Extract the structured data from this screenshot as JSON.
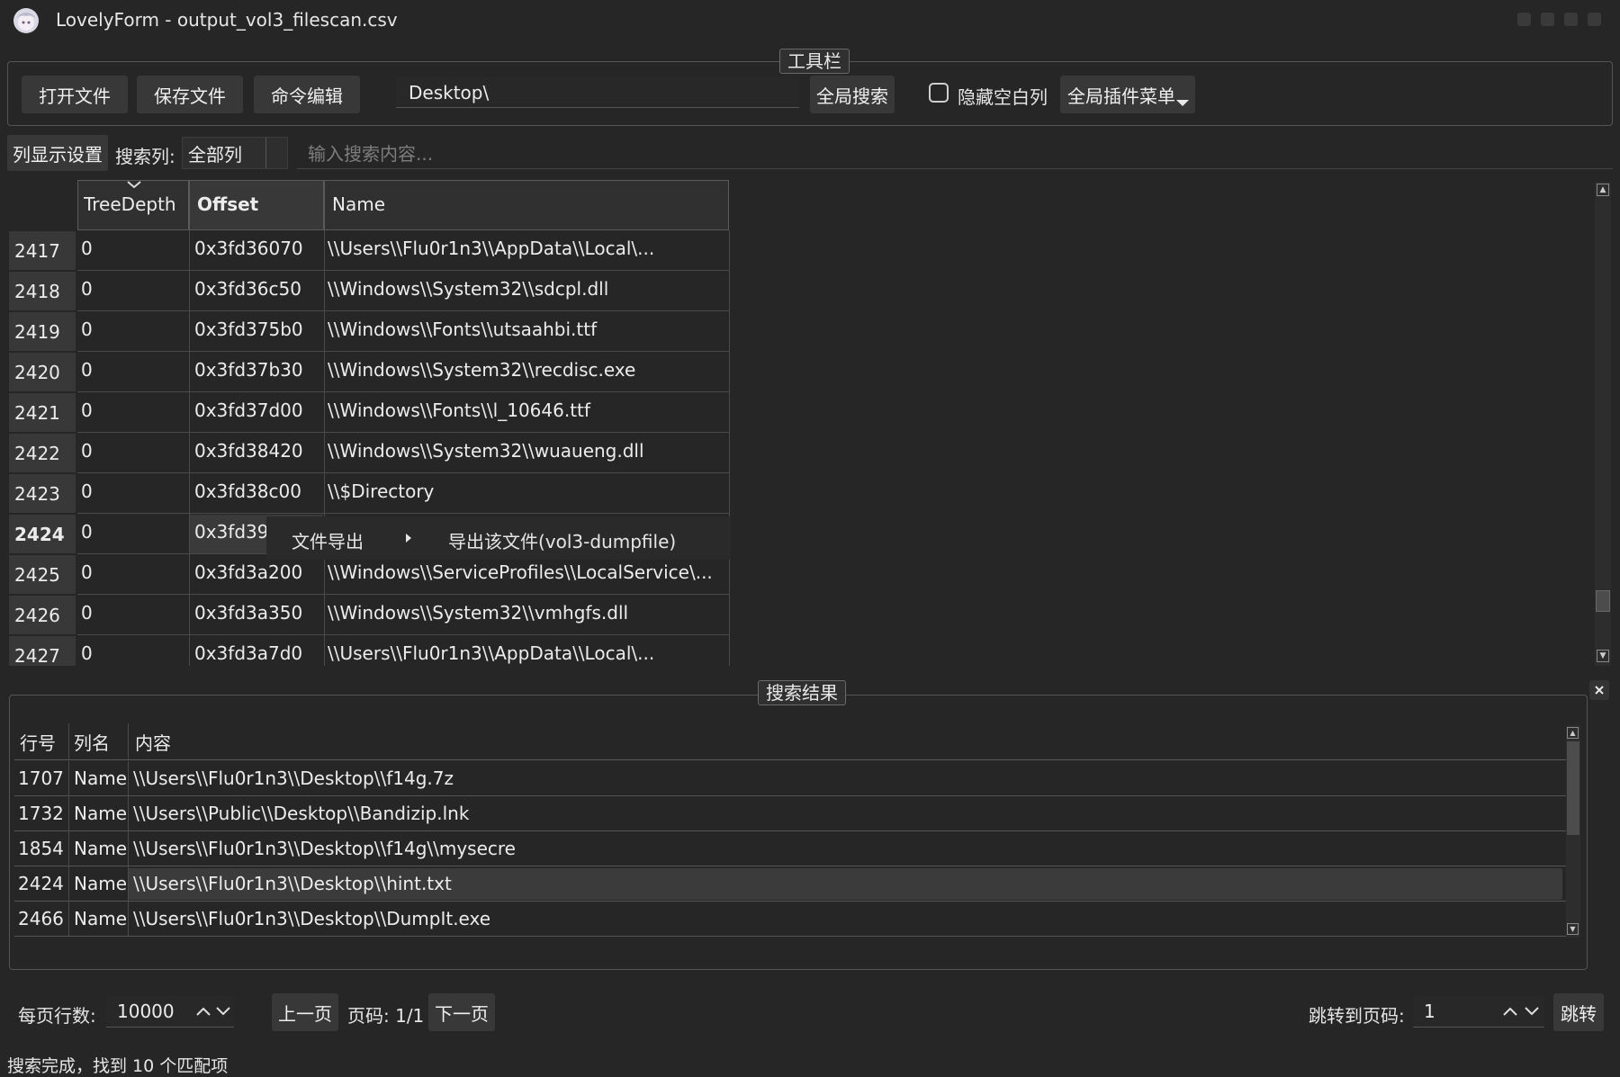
{
  "window": {
    "title": "LovelyForm - output_vol3_filescan.csv"
  },
  "toolbar": {
    "group_title": "工具栏",
    "open_file": "打开文件",
    "save_file": "保存文件",
    "command_edit": "命令编辑",
    "path_value": "Desktop\\",
    "global_search": "全局搜索",
    "hide_empty_columns": "隐藏空白列",
    "plugin_menu": "全局插件菜单"
  },
  "search_bar": {
    "column_display": "列显示设置",
    "search_column_label": "搜索列:",
    "search_column_value": "全部列",
    "search_placeholder": "输入搜索内容..."
  },
  "table": {
    "columns": [
      "TreeDepth",
      "Offset",
      "Name"
    ],
    "rows": [
      {
        "num": "2417",
        "depth": "0",
        "offset": "0x3fd36070",
        "name": "\\\\Users\\\\Flu0r1n3\\\\AppData\\\\Local\\..."
      },
      {
        "num": "2418",
        "depth": "0",
        "offset": "0x3fd36c50",
        "name": "\\\\Windows\\\\System32\\\\sdcpl.dll"
      },
      {
        "num": "2419",
        "depth": "0",
        "offset": "0x3fd375b0",
        "name": "\\\\Windows\\\\Fonts\\\\utsaahbi.ttf"
      },
      {
        "num": "2420",
        "depth": "0",
        "offset": "0x3fd37b30",
        "name": "\\\\Windows\\\\System32\\\\recdisc.exe"
      },
      {
        "num": "2421",
        "depth": "0",
        "offset": "0x3fd37d00",
        "name": "\\\\Windows\\\\Fonts\\\\l_10646.ttf"
      },
      {
        "num": "2422",
        "depth": "0",
        "offset": "0x3fd38420",
        "name": "\\\\Windows\\\\System32\\\\wuaueng.dll"
      },
      {
        "num": "2423",
        "depth": "0",
        "offset": "0x3fd38c00",
        "name": "\\\\$Directory"
      },
      {
        "num": "2424",
        "depth": "0",
        "offset": "0x3fd39",
        "name": ""
      },
      {
        "num": "2425",
        "depth": "0",
        "offset": "0x3fd3a200",
        "name": "\\\\Windows\\\\ServiceProfiles\\\\LocalService\\..."
      },
      {
        "num": "2426",
        "depth": "0",
        "offset": "0x3fd3a350",
        "name": "\\\\Windows\\\\System32\\\\vmhgfs.dll"
      },
      {
        "num": "2427",
        "depth": "0",
        "offset": "0x3fd3a7d0",
        "name": "\\\\Users\\\\Flu0r1n3\\\\AppData\\\\Local\\..."
      }
    ]
  },
  "context_menu": {
    "item": "文件导出",
    "submenu_item": "导出该文件(vol3-dumpfile)"
  },
  "results": {
    "group_title": "搜索结果",
    "columns": [
      "行号",
      "列名",
      "内容"
    ],
    "rows": [
      {
        "line": "1707",
        "col": "Name",
        "content": "\\\\Users\\\\Flu0r1n3\\\\Desktop\\\\f14g.7z"
      },
      {
        "line": "1732",
        "col": "Name",
        "content": "\\\\Users\\\\Public\\\\Desktop\\\\Bandizip.lnk"
      },
      {
        "line": "1854",
        "col": "Name",
        "content": "\\\\Users\\\\Flu0r1n3\\\\Desktop\\\\f14g\\\\mysecre"
      },
      {
        "line": "2424",
        "col": "Name",
        "content": "\\\\Users\\\\Flu0r1n3\\\\Desktop\\\\hint.txt"
      },
      {
        "line": "2466",
        "col": "Name",
        "content": "\\\\Users\\\\Flu0r1n3\\\\Desktop\\\\DumpIt.exe"
      }
    ]
  },
  "pagination": {
    "rows_per_page_label": "每页行数:",
    "rows_per_page_value": "10000",
    "prev": "上一页",
    "page_info": "页码: 1/1",
    "next": "下一页",
    "jump_label": "跳转到页码:",
    "jump_value": "1",
    "jump_button": "跳转"
  },
  "status": {
    "message": "搜索完成，找到 10 个匹配项"
  }
}
